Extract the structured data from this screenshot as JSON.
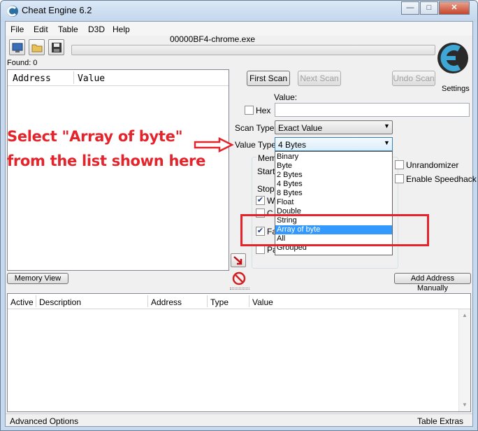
{
  "window": {
    "title": "Cheat Engine 6.2",
    "min_label": "—",
    "max_label": "□",
    "close_label": "✕"
  },
  "menu": [
    "File",
    "Edit",
    "Table",
    "D3D",
    "Help"
  ],
  "process_title": "00000BF4-chrome.exe",
  "found_label": "Found: 0",
  "results_columns": [
    "Address",
    "Value"
  ],
  "buttons": {
    "first_scan": "First Scan",
    "next_scan": "Next Scan",
    "undo_scan": "Undo Scan",
    "memory_view": "Memory View",
    "add_address": "Add Address Manually"
  },
  "logo": {
    "settings_label": "Settings"
  },
  "scan": {
    "value_label": "Value:",
    "hex_label": "Hex",
    "scan_type_label": "Scan Type",
    "scan_type_value": "Exact Value",
    "value_type_label": "Value Type",
    "value_type_value": "4 Bytes",
    "value_type_options": [
      "Binary",
      "Byte",
      "2 Bytes",
      "4 Bytes",
      "8 Bytes",
      "Float",
      "Double",
      "String",
      "Array of byte",
      "All",
      "Grouped"
    ],
    "highlighted_option": "Array of byte"
  },
  "memory_options": {
    "label_partial": "Mem",
    "start_partial": "Start",
    "stop_partial": "Stop",
    "writable_partial": "W",
    "copy_partial": "C",
    "fast_partial": "Fa",
    "pause_partial": "Pa"
  },
  "options_right": {
    "unrandomizer": "Unrandomizer",
    "enable_speedhack": "Enable Speedhack"
  },
  "address_list_columns": [
    "Active",
    "Description",
    "Address",
    "Type",
    "Value"
  ],
  "statusbar": {
    "advanced_options": "Advanced Options",
    "table_extras": "Table Extras"
  },
  "annotation": {
    "line1": "Select \"Array of byte\"",
    "line2": "from the list shown here"
  },
  "colors": {
    "annotation_red": "#e4232b",
    "highlight_blue": "#3399ff",
    "window_frame": "#c7d9ee"
  }
}
